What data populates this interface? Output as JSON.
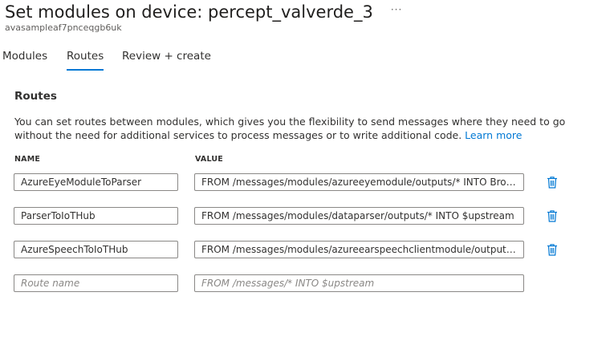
{
  "header": {
    "title": "Set modules on device: percept_valverde_3",
    "more_icon": "more-horizontal-icon",
    "more_glyph": "···",
    "subtitle": "avasampleaf7pnceqgb6uk"
  },
  "tabs": [
    {
      "label": "Modules",
      "active": false
    },
    {
      "label": "Routes",
      "active": true
    },
    {
      "label": "Review + create",
      "active": false
    }
  ],
  "routes": {
    "heading": "Routes",
    "description": "You can set routes between modules, which gives you the flexibility to send messages where they need to go without the need for additional services to process messages or to write additional code.",
    "learn_more": "Learn more",
    "columns": {
      "name": "NAME",
      "value": "VALUE"
    },
    "rows": [
      {
        "name": "AzureEyeModuleToParser",
        "value": "FROM /messages/modules/azureeyemodule/outputs/* INTO BrokeredEndpoint(\"/modules/dataparser/inputs/input\")"
      },
      {
        "name": "ParserToIoTHub",
        "value": "FROM /messages/modules/dataparser/outputs/* INTO $upstream"
      },
      {
        "name": "AzureSpeechToIoTHub",
        "value": "FROM /messages/modules/azureearspeechclientmodule/outputs/* INTO $upstream"
      }
    ],
    "new_row": {
      "name_placeholder": "Route name",
      "value_placeholder": "FROM /messages/* INTO $upstream"
    }
  },
  "colors": {
    "accent": "#0078d4",
    "text": "#323130",
    "border": "#8a8886"
  }
}
